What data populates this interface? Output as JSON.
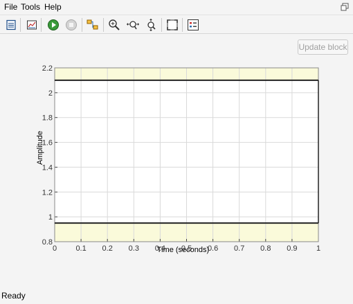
{
  "menu": {
    "file": "File",
    "tools": "Tools",
    "help": "Help"
  },
  "toolbar": {
    "buttons": [
      {
        "name": "print-icon"
      },
      {
        "name": "parameters-icon"
      },
      {
        "name": "run-icon"
      },
      {
        "name": "stop-icon"
      },
      {
        "name": "highlight-block-icon"
      },
      {
        "name": "zoom-in-icon"
      },
      {
        "name": "zoom-x-icon"
      },
      {
        "name": "zoom-y-icon"
      },
      {
        "name": "autoscale-icon"
      },
      {
        "name": "legend-icon"
      }
    ]
  },
  "update_button": {
    "label": "Update block"
  },
  "status": {
    "text": "Ready"
  },
  "colors": {
    "band": "#fafada",
    "plot_bg": "#ffffff",
    "grid": "#d9d9d9",
    "signal": "#222222"
  },
  "chart_data": {
    "type": "line",
    "title": "",
    "xlabel": "Time (seconds)",
    "ylabel": "Amplitude",
    "xlim": [
      0,
      1
    ],
    "ylim": [
      0.8,
      2.2
    ],
    "x_ticks": [
      "0",
      "0.1",
      "0.2",
      "0.3",
      "0.4",
      "0.5",
      "0.6",
      "0.7",
      "0.8",
      "0.9",
      "1"
    ],
    "y_ticks": [
      "0.8",
      "1",
      "1.2",
      "1.4",
      "1.6",
      "1.8",
      "2",
      "2.2"
    ],
    "bands": {
      "lower": [
        0.8,
        0.95
      ],
      "upper": [
        2.1,
        2.2
      ]
    },
    "series": [
      {
        "x": [
          0,
          1
        ],
        "y": [
          2.1,
          2.1
        ]
      },
      {
        "x": [
          0,
          1
        ],
        "y": [
          0.95,
          0.95
        ]
      }
    ],
    "grid": true
  }
}
